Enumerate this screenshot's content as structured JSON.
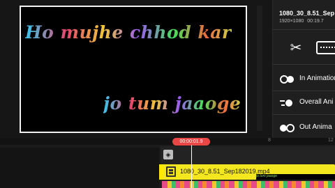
{
  "preview": {
    "caption_line1": "Ho mujhe chhod kar",
    "caption_line2": "jo tum jaaoge"
  },
  "clip_info": {
    "name": "1080_30_8.51_Sep",
    "resolution": "1920×1080",
    "duration": "00:19.7"
  },
  "tools": {
    "split_icon": "scissors-icon",
    "transform_icon": "transform-icon"
  },
  "animations": [
    {
      "label": "In Animation",
      "icon": "in-animation-icon"
    },
    {
      "label": "Overall Ani",
      "icon": "overall-animation-icon"
    },
    {
      "label": "Out Anima",
      "icon": "out-animation-icon"
    }
  ],
  "timeline": {
    "playhead_time": "00:00:01.9",
    "ruler_ticks": [
      "8",
      "12"
    ],
    "video_clip_name": "1080_30_8.51_Sep182019.mp4",
    "thumb_text": "jo tum jaaoge"
  },
  "colors": {
    "playhead_badge": "#e94646",
    "video_clip": "#f5e71f"
  }
}
